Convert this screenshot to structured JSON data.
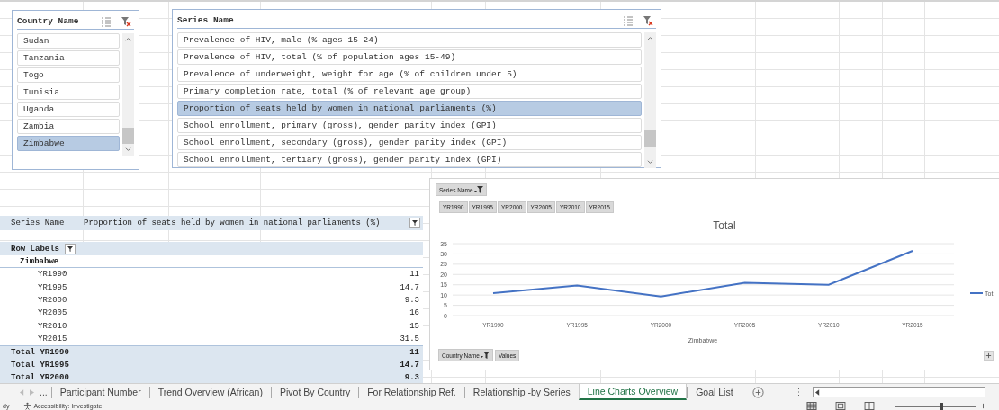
{
  "country_slicer": {
    "title": "Country Name",
    "items": [
      {
        "label": "Sudan",
        "selected": false
      },
      {
        "label": "Tanzania",
        "selected": false
      },
      {
        "label": "Togo",
        "selected": false
      },
      {
        "label": "Tunisia",
        "selected": false
      },
      {
        "label": "Uganda",
        "selected": false
      },
      {
        "label": "Zambia",
        "selected": false
      },
      {
        "label": "Zimbabwe",
        "selected": true
      }
    ]
  },
  "series_slicer": {
    "title": "Series Name",
    "items": [
      {
        "label": "Prevalence of HIV, male (% ages 15-24)",
        "selected": false
      },
      {
        "label": "Prevalence of HIV, total (% of population ages 15-49)",
        "selected": false
      },
      {
        "label": "Prevalence of underweight, weight for age (% of children under 5)",
        "selected": false
      },
      {
        "label": "Primary completion rate, total (% of relevant age group)",
        "selected": false
      },
      {
        "label": "Proportion of seats held by women in national parliaments (%)",
        "selected": true
      },
      {
        "label": "School enrollment, primary (gross), gender parity index (GPI)",
        "selected": false
      },
      {
        "label": "School enrollment, secondary (gross), gender parity index (GPI)",
        "selected": false
      },
      {
        "label": "School enrollment, tertiary (gross), gender parity index (GPI)",
        "selected": false
      }
    ]
  },
  "pivot_table": {
    "filter_label": "Series Name",
    "filter_value": "Proportion of seats held by women in national parliaments (%)",
    "row_labels": "Row Labels",
    "group": "Zimbabwe",
    "rows": [
      {
        "label": "YR1990",
        "value": "11"
      },
      {
        "label": "YR1995",
        "value": "14.7"
      },
      {
        "label": "YR2000",
        "value": "9.3"
      },
      {
        "label": "YR2005",
        "value": "16"
      },
      {
        "label": "YR2010",
        "value": "15"
      },
      {
        "label": "YR2015",
        "value": "31.5"
      }
    ],
    "totals": [
      {
        "label": "Total YR1990",
        "value": "11"
      },
      {
        "label": "Total YR1995",
        "value": "14.7"
      },
      {
        "label": "Total YR2000",
        "value": "9.3"
      }
    ]
  },
  "pivot_chart": {
    "filter_button": "Series Name",
    "year_buttons": [
      "YR1990",
      "YR1995",
      "YR2000",
      "YR2005",
      "YR2010",
      "YR2015"
    ],
    "chart_data": {
      "type": "line",
      "title": "Total",
      "xlabel": "Zimbabwe",
      "categories": [
        "YR1990",
        "YR1995",
        "YR2000",
        "YR2005",
        "YR2010",
        "YR2015"
      ],
      "series": [
        {
          "name": "Tot",
          "color": "#4472c4",
          "values": [
            11,
            14.7,
            9.3,
            16,
            15,
            31.5
          ]
        }
      ],
      "ylim": [
        0,
        35
      ],
      "yticks": [
        0,
        5,
        10,
        15,
        20,
        25,
        30,
        35
      ],
      "grid": true
    },
    "field_buttons": [
      "Country Name",
      "Values"
    ]
  },
  "sheet_tabs": {
    "overflow": "...",
    "tabs": [
      {
        "label": "Participant Number",
        "selected": false
      },
      {
        "label": "Trend Overview (African)",
        "selected": false
      },
      {
        "label": "Pivot By Country",
        "selected": false
      },
      {
        "label": "For Relationship Ref.",
        "selected": false
      },
      {
        "label": "Relationship -by Series",
        "selected": false
      },
      {
        "label": "Line Charts Overview",
        "selected": true
      },
      {
        "label": "Goal List",
        "selected": false
      }
    ]
  },
  "status_bar": {
    "mode": "dy",
    "accessibility": "Accessibility: Investigate",
    "zoom": {
      "level": 0.57
    }
  }
}
